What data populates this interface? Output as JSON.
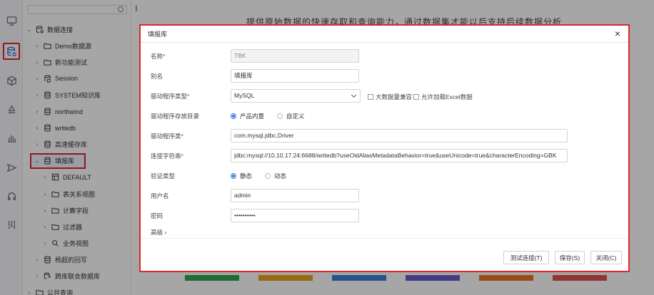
{
  "rail": {
    "icons": [
      "monitor-icon",
      "database-icon",
      "cube-icon",
      "layers-icon",
      "bar-chart-icon",
      "send-icon",
      "headset-icon",
      "tools-icon"
    ]
  },
  "tree": {
    "items": [
      {
        "label": "数据连接",
        "level": 0,
        "arrow": "⌄",
        "icon": "database-connection-icon"
      },
      {
        "label": "Demo数据源",
        "level": 1,
        "arrow": "›",
        "icon": "folder-icon"
      },
      {
        "label": "新功能测试",
        "level": 1,
        "arrow": "›",
        "icon": "folder-icon"
      },
      {
        "label": "Session",
        "level": 1,
        "arrow": "›",
        "icon": "session-icon"
      },
      {
        "label": "SYSTEM知识库",
        "level": 1,
        "arrow": "›",
        "icon": "database-icon"
      },
      {
        "label": "northwind",
        "level": 1,
        "arrow": "›",
        "icon": "database-icon"
      },
      {
        "label": "writedb",
        "level": 1,
        "arrow": "›",
        "icon": "database-icon"
      },
      {
        "label": "高速缓存库",
        "level": 1,
        "arrow": "›",
        "icon": "database-icon"
      },
      {
        "label": "填报库",
        "level": 1,
        "arrow": "⌄",
        "icon": "database-icon",
        "selected": true
      },
      {
        "label": "DEFAULT",
        "level": 2,
        "arrow": "›",
        "icon": "schema-icon"
      },
      {
        "label": "表关系视图",
        "level": 2,
        "arrow": "›",
        "icon": "folder-icon"
      },
      {
        "label": "计算字段",
        "level": 2,
        "arrow": "›",
        "icon": "folder-icon"
      },
      {
        "label": "过滤器",
        "level": 2,
        "arrow": "›",
        "icon": "folder-icon"
      },
      {
        "label": "业务视图",
        "level": 2,
        "arrow": "›",
        "icon": "search-icon"
      },
      {
        "label": "杨超的回写",
        "level": 1,
        "arrow": "›",
        "icon": "database-icon"
      },
      {
        "label": "跨库联合数据库",
        "level": 1,
        "arrow": "›",
        "icon": "multi-db-icon"
      },
      {
        "label": "公共查询",
        "level": 0,
        "arrow": "›",
        "icon": "folder-icon"
      }
    ]
  },
  "background": {
    "title": "提供原始数据的快速存取和查询能力，通过数据集才能以后支持后续数据分析"
  },
  "dialog": {
    "title": "填报库",
    "fields": {
      "name": {
        "label": "名称",
        "value": "TBK"
      },
      "alias": {
        "label": "别名",
        "value": "填报库"
      },
      "driver_type": {
        "label": "驱动程序类型",
        "value": "MySQL"
      },
      "big_data_compat": {
        "label": "大数据量兼容"
      },
      "allow_excel": {
        "label": "允许加载Excel数据"
      },
      "driver_dir": {
        "label": "驱动程序存放目录",
        "option1": "产品内置",
        "option2": "自定义"
      },
      "driver_class": {
        "label": "驱动程序类",
        "value": "com.mysql.jdbc.Driver"
      },
      "conn_string": {
        "label": "连接字符串",
        "value": "jdbc:mysql://10.10.17.24:6688/writedb?useOldAliasMetadataBehavior=true&useUnicode=true&characterEncoding=GBK"
      },
      "auth_type": {
        "label": "验证类型",
        "option1": "静态",
        "option2": "动态"
      },
      "username": {
        "label": "用户名",
        "value": "admin"
      },
      "password": {
        "label": "密码",
        "value": "••••••••••"
      }
    },
    "advanced_label": "高级 ›",
    "buttons": {
      "test": "测试连接(T)",
      "save": "保存(S)",
      "close": "关闭(C)"
    },
    "close_glyph": "×"
  },
  "colors": {
    "accent": "#2f6ee0",
    "highlight": "#e0262b",
    "bars": [
      "#2fa84f",
      "#e8a317",
      "#3b7fd4",
      "#6b5fc9",
      "#e8742d",
      "#d9534f"
    ]
  }
}
